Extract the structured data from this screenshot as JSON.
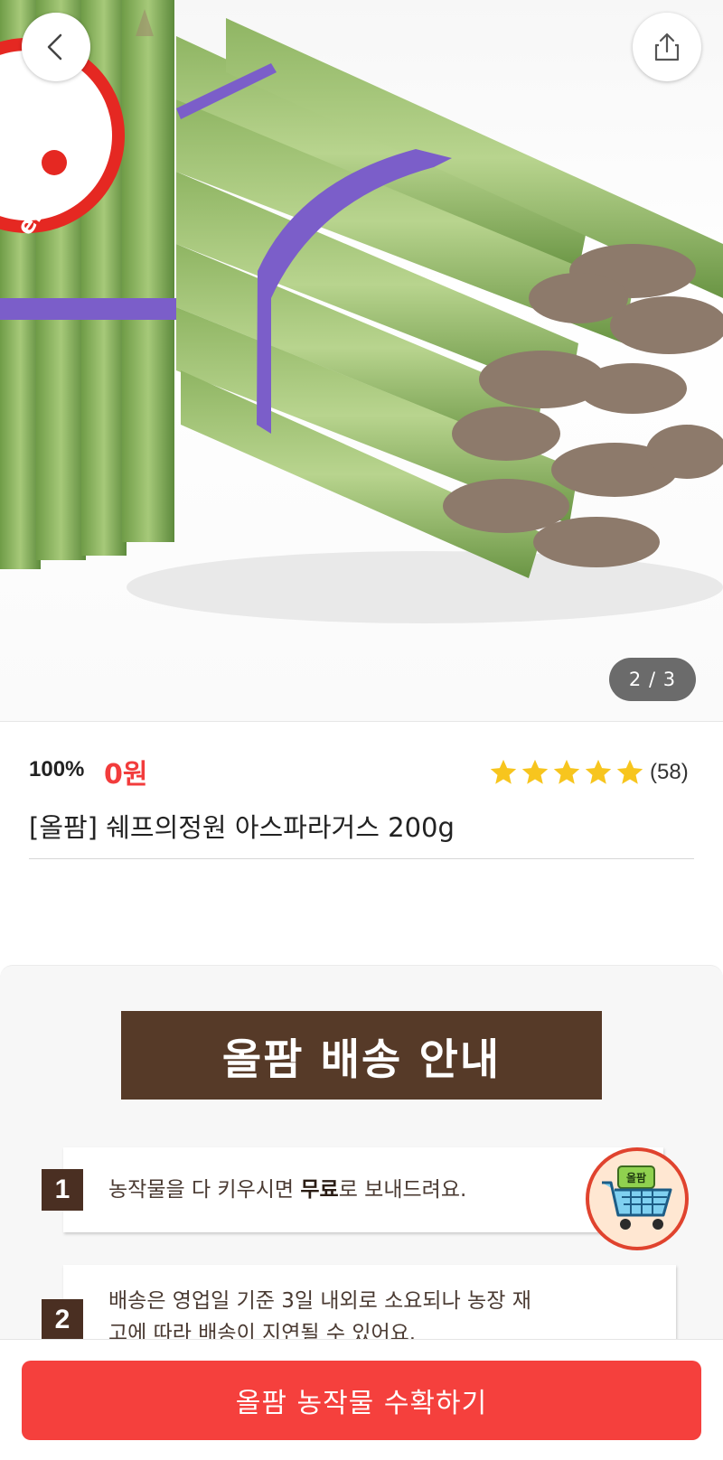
{
  "gallery": {
    "current_page": "2",
    "separator": "/",
    "total_pages": "3",
    "page_indicator": "2 / 3",
    "seal_text": "en.co.kr"
  },
  "nav": {
    "back_icon": "chevron-left-icon",
    "share_icon": "share-icon"
  },
  "product": {
    "discount": "100%",
    "price": "0원",
    "rating_stars": 5,
    "review_count": "(58)",
    "title": "[올팜] 쉐프의정원 아스파라거스 200g"
  },
  "delivery_info": {
    "banner": "올팜 배송 안내",
    "steps": [
      {
        "number": "1",
        "text_before": "농작물을 다 키우시면 ",
        "text_bold": "무료",
        "text_after": "로 보내드려요."
      },
      {
        "number": "2",
        "line1": "배송은 영업일 기준 3일 내외로 소요되나 농장 재",
        "line2": "고에 따라 배송이 지연될 수 있어요."
      }
    ]
  },
  "cart_fab": {
    "badge": "올팜",
    "icon": "cart-icon"
  },
  "cta": {
    "label": "올팜 농작물 수확하기"
  },
  "colors": {
    "accent_red": "#f5403d",
    "price_red": "#f23c3c",
    "star_yellow": "#f7c51e",
    "banner_brown": "#563a28",
    "step_brown": "#4a2f22"
  }
}
